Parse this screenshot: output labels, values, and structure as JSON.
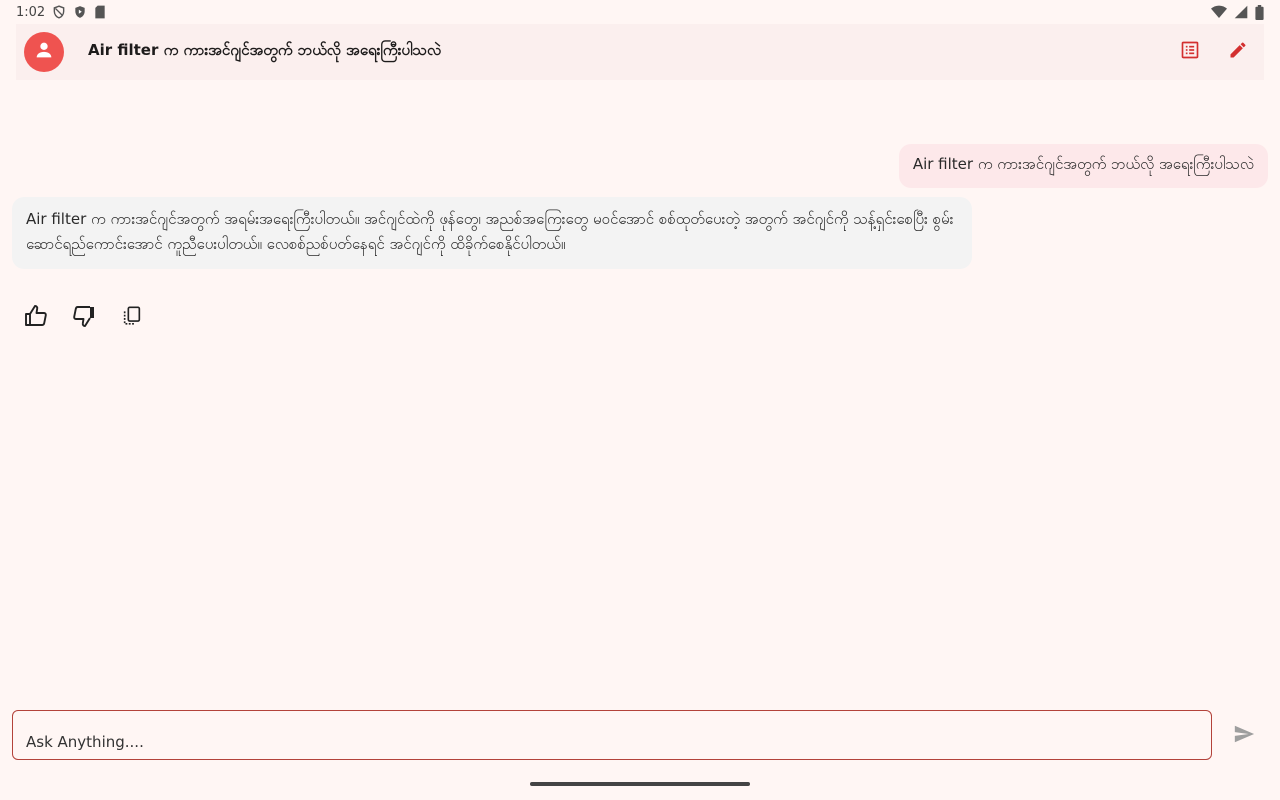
{
  "status_bar": {
    "time": "1:02"
  },
  "app_bar": {
    "title": "Air filter က ကားအင်ဂျင်အတွက် ဘယ်လို အရေးကြီးပါသလဲ",
    "accent_color": "#d32f2f",
    "avatar_color": "#ef5350"
  },
  "chat": {
    "user_message": "Air filter က ကားအင်ဂျင်အတွက် ဘယ်လို အရေးကြီးပါသလဲ",
    "bot_message": "Air filter က ကားအင်ဂျင်အတွက် အရမ်းအရေးကြီးပါတယ်။ အင်ဂျင်ထဲကို ဖုန်တွေ၊ အညစ်အကြေးတွေ မဝင်အောင် စစ်ထုတ်ပေးတဲ့ အတွက် အင်ဂျင်ကို သန့်ရှင်းစေပြီး စွမ်းဆောင်ရည်ကောင်းအောင် ကူညီပေးပါတယ်။ လေစစ်ညစ်ပတ်နေရင် အင်ဂျင်ကို ထိခိုက်စေနိုင်ပါတယ်။"
  },
  "feedback": {
    "icons": [
      "thumb-up-icon",
      "thumb-down-icon",
      "copy-icon"
    ]
  },
  "input": {
    "placeholder": "Ask Anything...."
  }
}
